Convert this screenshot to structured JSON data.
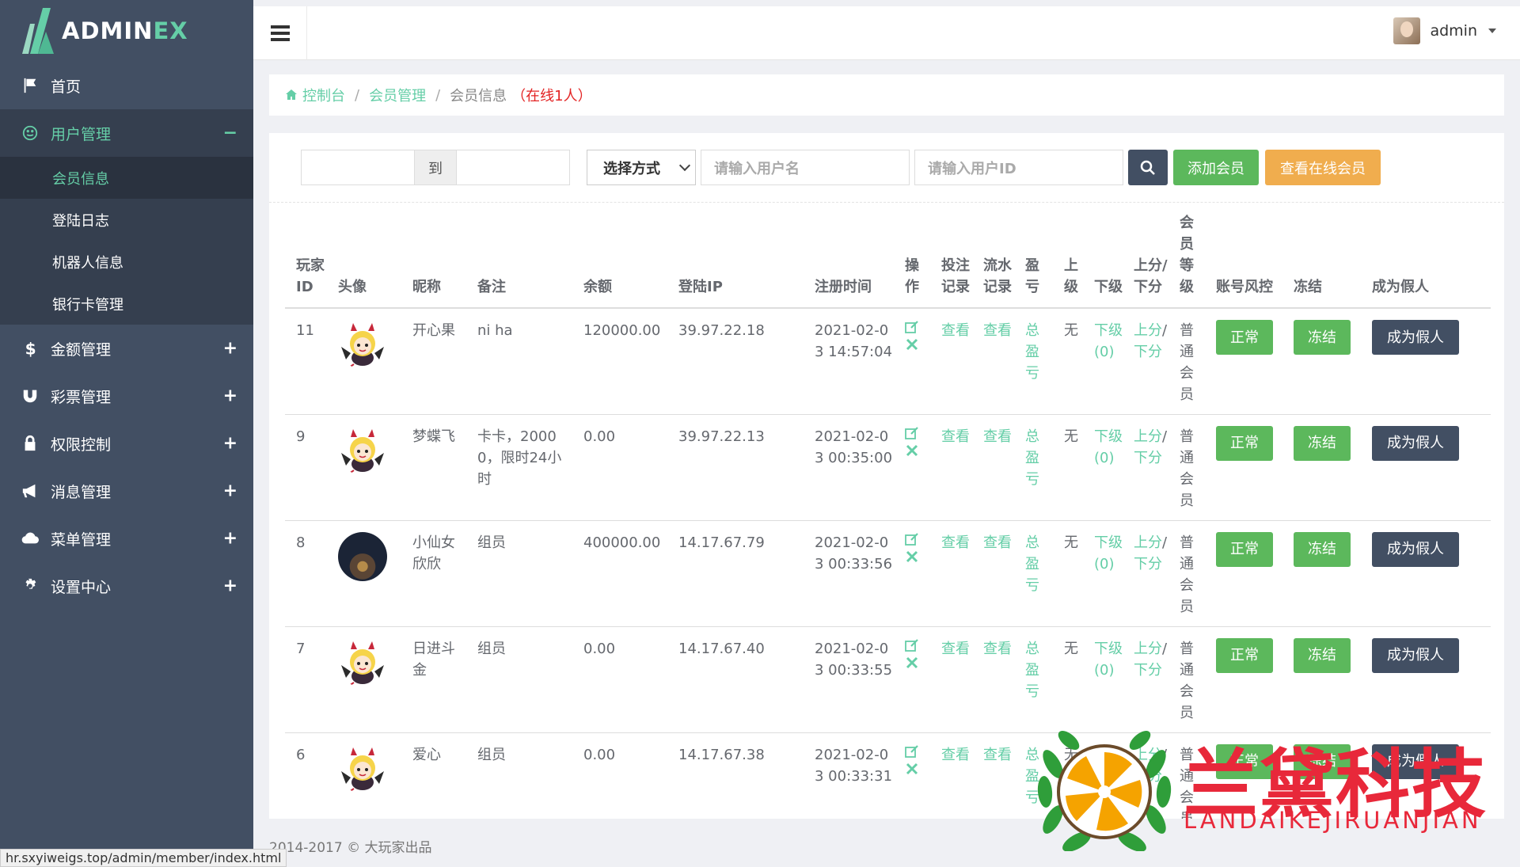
{
  "app": {
    "logo_main": "ADMIN",
    "logo_accent": "EX"
  },
  "sidebar": {
    "items": [
      {
        "label": "首页",
        "icon": "flag-icon"
      },
      {
        "label": "用户管理",
        "icon": "smile-icon",
        "toggle": "−"
      },
      {
        "label": "金额管理",
        "icon": "dollar-icon",
        "toggle": "+"
      },
      {
        "label": "彩票管理",
        "icon": "magnet-icon",
        "toggle": "+"
      },
      {
        "label": "权限控制",
        "icon": "lock-icon",
        "toggle": "+"
      },
      {
        "label": "消息管理",
        "icon": "bullhorn-icon",
        "toggle": "+"
      },
      {
        "label": "菜单管理",
        "icon": "cloud-icon",
        "toggle": "+"
      },
      {
        "label": "设置中心",
        "icon": "gear-icon",
        "toggle": "+"
      }
    ],
    "sub_items": [
      "会员信息",
      "登陆日志",
      "机器人信息",
      "银行卡管理"
    ]
  },
  "header": {
    "user": "admin"
  },
  "breadcrumb": {
    "home": "控制台",
    "section": "会员管理",
    "current": "会员信息",
    "online": "（在线1人）",
    "sep": "/"
  },
  "toolbar": {
    "date_separator": "到",
    "select_value": "选择方式",
    "username_placeholder": "请输入用户名",
    "userid_placeholder": "请输入用户ID",
    "add_label": "添加会员",
    "online_label": "查看在线会员"
  },
  "table": {
    "headers": [
      "玩家ID",
      "头像",
      "昵称",
      "备注",
      "余额",
      "登陆IP",
      "注册时间",
      "操作",
      "投注记录",
      "流水记录",
      "盈亏",
      "上级",
      "下级",
      "上分/下分",
      "会员等级",
      "账号风控",
      "冻结",
      "成为假人"
    ],
    "rows": [
      {
        "id": "11",
        "nick": "开心果",
        "note": "ni ha",
        "balance": "120000.00",
        "ip": "39.97.22.18",
        "reg": "2021-02-03 14:57:04",
        "avatar": "devil"
      },
      {
        "id": "9",
        "nick": "梦蝶飞",
        "note": "卡卡，20000，限时24小时",
        "balance": "0.00",
        "ip": "39.97.22.13",
        "reg": "2021-02-03 00:35:00",
        "avatar": "devil"
      },
      {
        "id": "8",
        "nick": "小仙女欣欣",
        "note": "组员",
        "balance": "400000.00",
        "ip": "14.17.67.79",
        "reg": "2021-02-03 00:33:56",
        "avatar": "photo"
      },
      {
        "id": "7",
        "nick": "日进斗金",
        "note": "组员",
        "balance": "0.00",
        "ip": "14.17.67.40",
        "reg": "2021-02-03 00:33:55",
        "avatar": "devil"
      },
      {
        "id": "6",
        "nick": "爱心",
        "note": "组员",
        "balance": "0.00",
        "ip": "14.17.67.38",
        "reg": "2021-02-03 00:33:31",
        "avatar": "devil"
      }
    ],
    "cells": {
      "bet": "查看",
      "flow": "查看",
      "profit": "总盈亏",
      "parent": "无",
      "child": "下级(0)",
      "up": "上分",
      "slash": "/",
      "down": "下分",
      "level": "普通会员",
      "risk": "正常",
      "freeze": "冻结",
      "fake": "成为假人"
    }
  },
  "footer": {
    "copyright": "2014-2017 © 大玩家出品"
  },
  "statusbar": {
    "url": "hr.sxyiweigs.top/admin/member/index.html"
  },
  "watermark": {
    "title": "兰黛科技",
    "subtitle": "LANDAIKEJIRUANJIAN"
  },
  "colors": {
    "sidebar": "#424f63",
    "accent": "#65cea7",
    "success": "#5cb85c",
    "warning": "#f0ad4e",
    "danger": "#e32424"
  }
}
